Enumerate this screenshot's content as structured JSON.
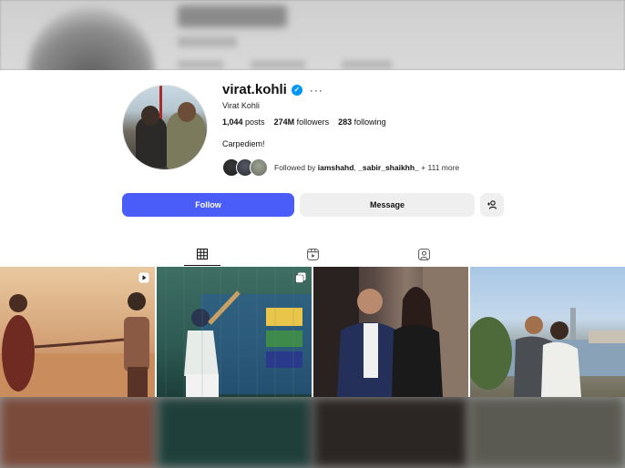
{
  "profile": {
    "username": "virat.kohli",
    "full_name": "Virat Kohli",
    "more_label": "···",
    "verified_check": "✓",
    "posts_count": "1,044",
    "posts_label": "posts",
    "followers_count": "274M",
    "followers_label": "followers",
    "following_count": "283",
    "following_label": "following",
    "bio": "Carpediem!",
    "followed_by_prefix": "Followed by",
    "followed_by_user1": "iamshahd",
    "followed_by_sep": ",",
    "followed_by_user2": "_sabir_shaikhh_",
    "followed_by_more": "+ 111 more"
  },
  "actions": {
    "follow_label": "Follow",
    "message_label": "Message",
    "add_icon": "+👤"
  },
  "tabs": [
    {
      "name": "posts",
      "icon": "grid-icon"
    },
    {
      "name": "reels",
      "icon": "reels-icon"
    },
    {
      "name": "tagged",
      "icon": "tagged-icon"
    }
  ],
  "posts": [
    {
      "type": "reel",
      "icon": "reel-icon"
    },
    {
      "type": "carousel",
      "icon": "carousel-icon"
    },
    {
      "type": "photo",
      "icon": ""
    },
    {
      "type": "photo",
      "icon": ""
    }
  ],
  "colors": {
    "follow_button": "#4a5df9",
    "verified": "#0095f6",
    "secondary_button": "#efefef"
  }
}
